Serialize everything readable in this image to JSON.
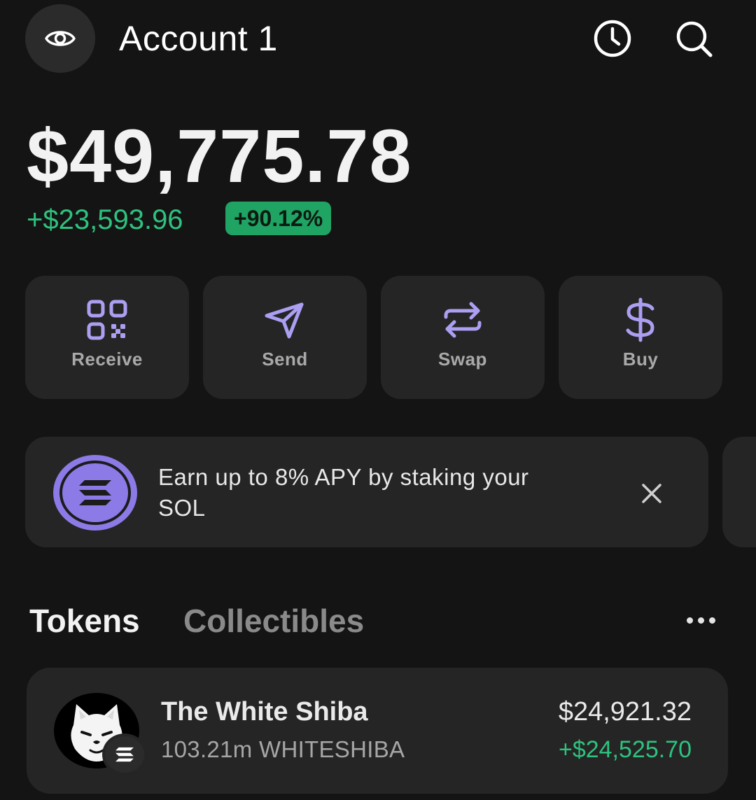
{
  "header": {
    "account_name": "Account 1",
    "icons": {
      "visibility": "eye-icon",
      "history": "clock-icon",
      "search": "search-icon"
    }
  },
  "balance": {
    "total": "$49,775.78",
    "change_usd": "+$23,593.96",
    "change_pct": "+90.12%"
  },
  "actions": [
    {
      "label": "Receive",
      "icon": "qr-code-icon"
    },
    {
      "label": "Send",
      "icon": "send-icon"
    },
    {
      "label": "Swap",
      "icon": "swap-icon"
    },
    {
      "label": "Buy",
      "icon": "dollar-icon"
    }
  ],
  "promo": {
    "text": "Earn up to 8% APY by staking your SOL",
    "icon": "solana-logo-icon"
  },
  "tabs": {
    "tokens": "Tokens",
    "collectibles": "Collectibles"
  },
  "tokens": [
    {
      "name": "The White Shiba",
      "amount": "103.21m WHITESHIBA",
      "value": "$24,921.32",
      "pnl": "+$24,525.70"
    }
  ],
  "colors": {
    "background": "#141414",
    "card": "#252525",
    "accent": "#ab9ff2",
    "positive": "#2ec27e",
    "positive_badge": "#1fa463"
  }
}
